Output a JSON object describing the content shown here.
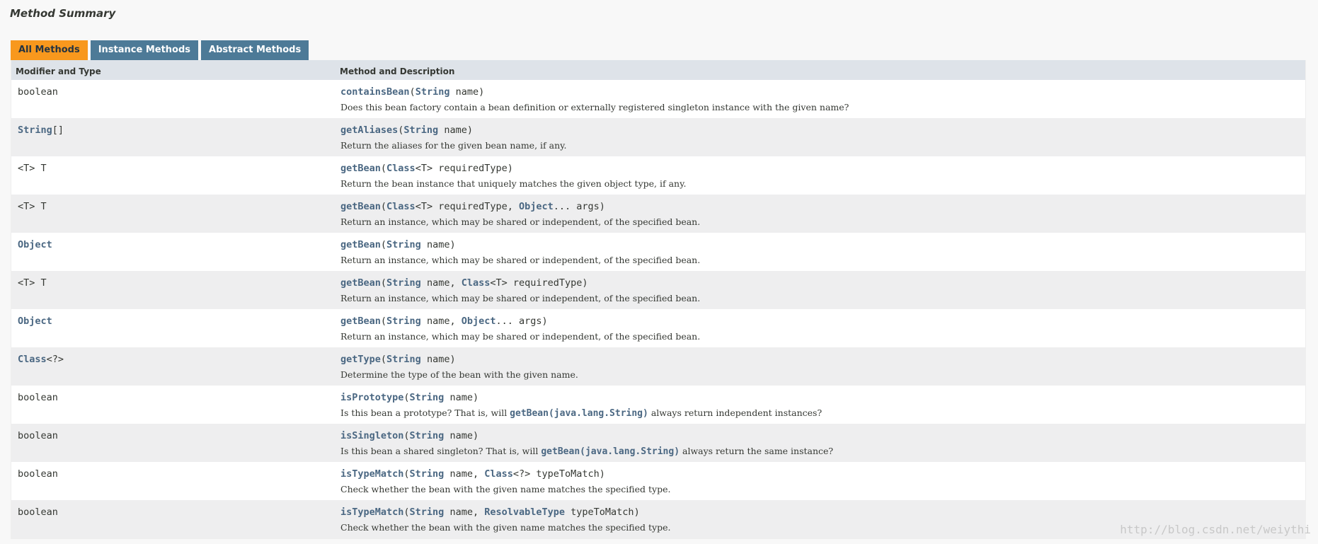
{
  "section_title": "Method Summary",
  "tabs": [
    {
      "label": "All Methods",
      "active": true
    },
    {
      "label": "Instance Methods",
      "active": false
    },
    {
      "label": "Abstract Methods",
      "active": false
    }
  ],
  "table": {
    "headers": [
      "Modifier and Type",
      "Method and Description"
    ],
    "rows": [
      {
        "type": [
          {
            "t": "boolean",
            "link": false
          }
        ],
        "sig": [
          {
            "t": "containsBean",
            "link": true
          },
          {
            "t": "(",
            "link": false
          },
          {
            "t": "String",
            "link": true
          },
          {
            "t": " name)",
            "link": false
          }
        ],
        "desc": [
          {
            "t": "Does this bean factory contain a bean definition or externally registered singleton instance with the given name?",
            "code": false
          }
        ]
      },
      {
        "type": [
          {
            "t": "String",
            "link": true
          },
          {
            "t": "[]",
            "link": false
          }
        ],
        "sig": [
          {
            "t": "getAliases",
            "link": true
          },
          {
            "t": "(",
            "link": false
          },
          {
            "t": "String",
            "link": true
          },
          {
            "t": " name)",
            "link": false
          }
        ],
        "desc": [
          {
            "t": "Return the aliases for the given bean name, if any.",
            "code": false
          }
        ]
      },
      {
        "type": [
          {
            "t": "<T> T",
            "link": false
          }
        ],
        "sig": [
          {
            "t": "getBean",
            "link": true
          },
          {
            "t": "(",
            "link": false
          },
          {
            "t": "Class",
            "link": true
          },
          {
            "t": "<T> requiredType)",
            "link": false
          }
        ],
        "desc": [
          {
            "t": "Return the bean instance that uniquely matches the given object type, if any.",
            "code": false
          }
        ]
      },
      {
        "type": [
          {
            "t": "<T> T",
            "link": false
          }
        ],
        "sig": [
          {
            "t": "getBean",
            "link": true
          },
          {
            "t": "(",
            "link": false
          },
          {
            "t": "Class",
            "link": true
          },
          {
            "t": "<T> requiredType, ",
            "link": false
          },
          {
            "t": "Object",
            "link": true
          },
          {
            "t": "... args)",
            "link": false
          }
        ],
        "desc": [
          {
            "t": "Return an instance, which may be shared or independent, of the specified bean.",
            "code": false
          }
        ]
      },
      {
        "type": [
          {
            "t": "Object",
            "link": true
          }
        ],
        "sig": [
          {
            "t": "getBean",
            "link": true
          },
          {
            "t": "(",
            "link": false
          },
          {
            "t": "String",
            "link": true
          },
          {
            "t": " name)",
            "link": false
          }
        ],
        "desc": [
          {
            "t": "Return an instance, which may be shared or independent, of the specified bean.",
            "code": false
          }
        ]
      },
      {
        "type": [
          {
            "t": "<T> T",
            "link": false
          }
        ],
        "sig": [
          {
            "t": "getBean",
            "link": true
          },
          {
            "t": "(",
            "link": false
          },
          {
            "t": "String",
            "link": true
          },
          {
            "t": " name, ",
            "link": false
          },
          {
            "t": "Class",
            "link": true
          },
          {
            "t": "<T> requiredType)",
            "link": false
          }
        ],
        "desc": [
          {
            "t": "Return an instance, which may be shared or independent, of the specified bean.",
            "code": false
          }
        ]
      },
      {
        "type": [
          {
            "t": "Object",
            "link": true
          }
        ],
        "sig": [
          {
            "t": "getBean",
            "link": true
          },
          {
            "t": "(",
            "link": false
          },
          {
            "t": "String",
            "link": true
          },
          {
            "t": " name, ",
            "link": false
          },
          {
            "t": "Object",
            "link": true
          },
          {
            "t": "... args)",
            "link": false
          }
        ],
        "desc": [
          {
            "t": "Return an instance, which may be shared or independent, of the specified bean.",
            "code": false
          }
        ]
      },
      {
        "type": [
          {
            "t": "Class",
            "link": true
          },
          {
            "t": "<?>",
            "link": false
          }
        ],
        "sig": [
          {
            "t": "getType",
            "link": true
          },
          {
            "t": "(",
            "link": false
          },
          {
            "t": "String",
            "link": true
          },
          {
            "t": " name)",
            "link": false
          }
        ],
        "desc": [
          {
            "t": "Determine the type of the bean with the given name.",
            "code": false
          }
        ]
      },
      {
        "type": [
          {
            "t": "boolean",
            "link": false
          }
        ],
        "sig": [
          {
            "t": "isPrototype",
            "link": true
          },
          {
            "t": "(",
            "link": false
          },
          {
            "t": "String",
            "link": true
          },
          {
            "t": " name)",
            "link": false
          }
        ],
        "desc": [
          {
            "t": "Is this bean a prototype? That is, will ",
            "code": false
          },
          {
            "t": "getBean(java.lang.String)",
            "code": true
          },
          {
            "t": " always return independent instances?",
            "code": false
          }
        ]
      },
      {
        "type": [
          {
            "t": "boolean",
            "link": false
          }
        ],
        "sig": [
          {
            "t": "isSingleton",
            "link": true
          },
          {
            "t": "(",
            "link": false
          },
          {
            "t": "String",
            "link": true
          },
          {
            "t": " name)",
            "link": false
          }
        ],
        "desc": [
          {
            "t": "Is this bean a shared singleton? That is, will ",
            "code": false
          },
          {
            "t": "getBean(java.lang.String)",
            "code": true
          },
          {
            "t": " always return the same instance?",
            "code": false
          }
        ]
      },
      {
        "type": [
          {
            "t": "boolean",
            "link": false
          }
        ],
        "sig": [
          {
            "t": "isTypeMatch",
            "link": true
          },
          {
            "t": "(",
            "link": false
          },
          {
            "t": "String",
            "link": true
          },
          {
            "t": " name, ",
            "link": false
          },
          {
            "t": "Class",
            "link": true
          },
          {
            "t": "<?> typeToMatch)",
            "link": false
          }
        ],
        "desc": [
          {
            "t": "Check whether the bean with the given name matches the specified type.",
            "code": false
          }
        ]
      },
      {
        "type": [
          {
            "t": "boolean",
            "link": false
          }
        ],
        "sig": [
          {
            "t": "isTypeMatch",
            "link": true
          },
          {
            "t": "(",
            "link": false
          },
          {
            "t": "String",
            "link": true
          },
          {
            "t": " name, ",
            "link": false
          },
          {
            "t": "ResolvableType",
            "link": true
          },
          {
            "t": " typeToMatch)",
            "link": false
          }
        ],
        "desc": [
          {
            "t": "Check whether the bean with the given name matches the specified type.",
            "code": false
          }
        ]
      }
    ]
  },
  "watermark": "http://blog.csdn.net/weiythi",
  "colors": {
    "tab_active": "#f8981d",
    "tab_inactive": "#4d7a97",
    "header_bg": "#dee3e9",
    "link": "#4a6782",
    "row_alt": "#eeeeef"
  }
}
